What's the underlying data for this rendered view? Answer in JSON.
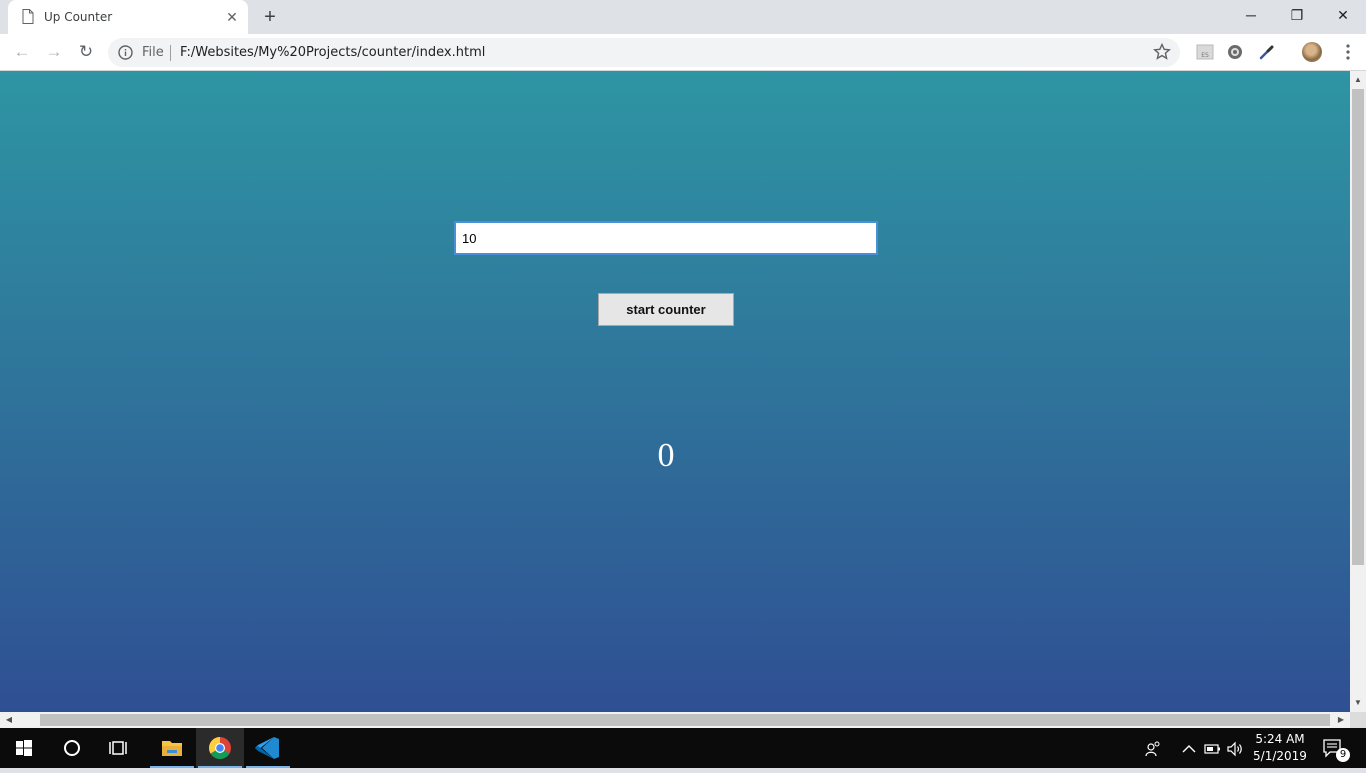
{
  "browser": {
    "tab": {
      "title": "Up Counter",
      "close_glyph": "✕"
    },
    "new_tab_glyph": "+",
    "window_controls": {
      "minimize": "─",
      "restore": "❐",
      "close": "✕"
    },
    "nav": {
      "back": "←",
      "forward": "→",
      "reload": "↻"
    },
    "address_bar": {
      "scheme_label": "File",
      "url": "F:/Websites/My%20Projects/counter/index.html"
    },
    "extensions": [
      "es-extension-icon",
      "gear-extension-icon",
      "eyedropper-extension-icon"
    ]
  },
  "page": {
    "input": {
      "value": "10"
    },
    "start_button": {
      "label": "start counter"
    },
    "counter_display": "0",
    "background": {
      "top": "#2e95a3",
      "bottom": "#2f4f93"
    }
  },
  "taskbar": {
    "apps": [
      "start-icon",
      "cortana-icon",
      "task-view-icon",
      "file-explorer-icon",
      "chrome-icon",
      "vscode-icon"
    ],
    "clock": {
      "time": "5:24 AM",
      "date": "5/1/2019"
    },
    "notification_count": "9"
  }
}
